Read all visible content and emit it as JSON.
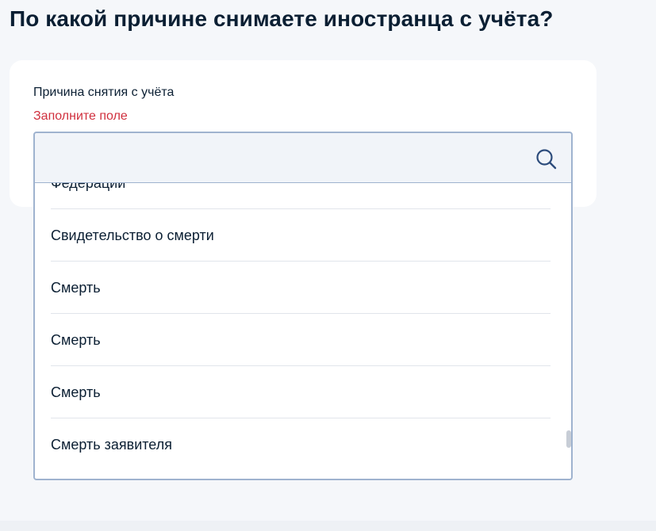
{
  "page": {
    "title": "По какой причине снимаете иностранца с учёта?"
  },
  "form": {
    "field_label": "Причина снятия с учёта",
    "error_text": "Заполните поле",
    "search_value": "",
    "search_placeholder": "",
    "search_icon": "search-icon"
  },
  "dropdown": {
    "options": [
      "Федерации",
      "Свидетельство о смерти",
      "Смерть",
      "Смерть",
      "Смерть",
      "Смерть заявителя"
    ]
  },
  "colors": {
    "title": "#0b1f33",
    "error": "#d0303e",
    "field_border": "#9fb3cf",
    "field_bg": "#f1f4f9",
    "icon": "#2d4c7c",
    "page_bg": "#f5f7fa"
  }
}
